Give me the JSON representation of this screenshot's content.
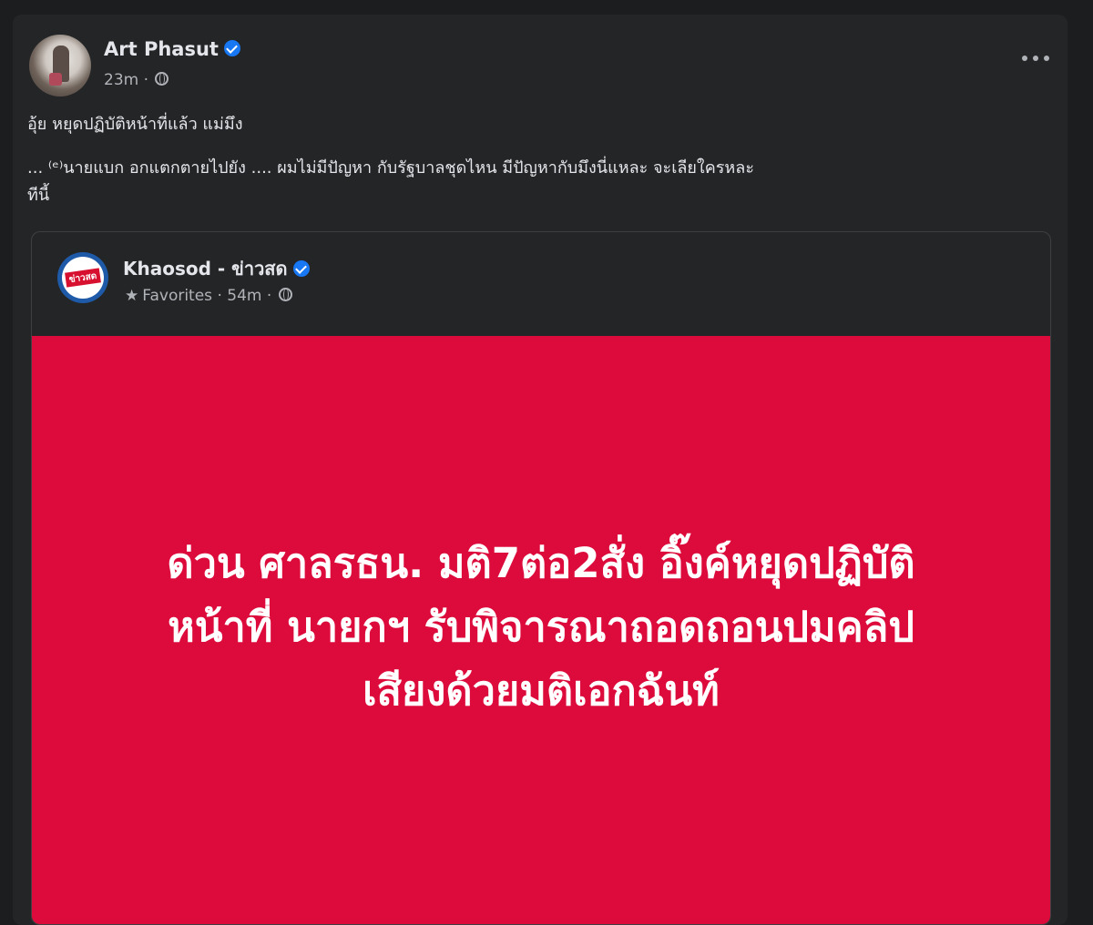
{
  "post": {
    "author": "Art Phasut",
    "time": "23m ·",
    "text_line1": "อุ้ย หยุดปฏิบัติหน้าที่แล้ว แม่มึง",
    "text_line2": "...    ⁽ᵉ⁾นายแบก อกแตกตายไปยัง .... ผมไม่มีปัญหา กับรัฐบาลชุดไหน มีปัญหากับมึงนี่แหละ จะเลียใครหละ",
    "text_line3": "ทีนี้"
  },
  "shared": {
    "page_name": "Khaosod - ข่าวสด",
    "logo_text": "ข่าวสด",
    "meta": "Favorites · 54m ·",
    "headline_line1": "ด่วน ศาลรธน. มติ7ต่อ2สั่ง อิ๊งค์หยุดปฏิบัติ",
    "headline_line2": "หน้าที่ นายกฯ รับพิจารณาถอดถอนปมคลิป",
    "headline_line3": "เสียงด้วยมติเอกฉันท์"
  },
  "icons": {
    "verified": "verified-badge-icon",
    "globe": "globe-icon",
    "more": "more-options-icon",
    "star": "star-icon"
  },
  "colors": {
    "background": "#1c1d1f",
    "card": "#242526",
    "verified": "#1877f2",
    "headline_bg": "#dc0b3b"
  }
}
